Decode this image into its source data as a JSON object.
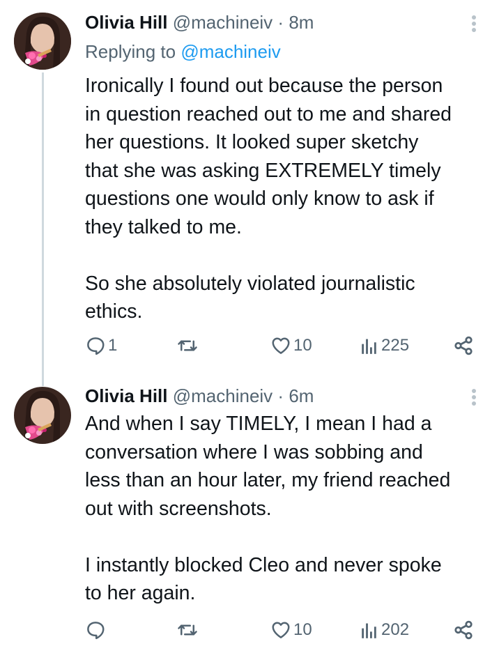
{
  "tweets": [
    {
      "author_name": "Olivia Hill",
      "handle": "@machineiv",
      "separator": "·",
      "time": "8m",
      "replying_prefix": "Replying to ",
      "replying_to": "@machineiv",
      "text": "Ironically I found out because the person\nin question reached out to me and shared\nher questions. It looked super sketchy\nthat she was asking EXTREMELY timely\nquestions one would only know to ask if\nthey talked to me.\n\nSo she absolutely violated journalistic\nethics.",
      "reply_count": "1",
      "like_count": "10",
      "view_count": "225"
    },
    {
      "author_name": "Olivia Hill",
      "handle": "@machineiv",
      "separator": "·",
      "time": "6m",
      "text": "And when I say TIMELY, I mean I had a\nconversation where I was sobbing and\nless than an hour later, my friend reached\nout with screenshots.\n\nI instantly blocked Cleo and never spoke\nto her again.",
      "reply_count": "",
      "like_count": "10",
      "view_count": "202"
    }
  ],
  "icons": {
    "reply": "comment-bubble-icon",
    "retweet": "retweet-icon",
    "like": "heart-icon",
    "views": "bar-chart-icon",
    "share": "share-nodes-icon",
    "more": "vertical-ellipsis-icon"
  },
  "colors": {
    "text": "#0f1419",
    "secondary": "#536471",
    "link": "#1d9bf0",
    "thread_line": "#cfd9de"
  }
}
